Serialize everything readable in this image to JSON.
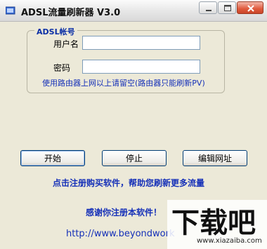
{
  "window": {
    "title": "ADSL流量刷新器 V3.0",
    "icon": "app-icon"
  },
  "controls": {
    "minimize": "minimize-icon",
    "maximize": "maximize-icon",
    "close": "close-icon"
  },
  "account": {
    "group_title": "ADSL帐号",
    "username_label": "用户名",
    "username_value": "",
    "password_label": "密码",
    "password_value": "",
    "hint": "使用路由器上网以上请留空(路由器只能刷新PV)"
  },
  "buttons": {
    "start": "开始",
    "stop": "停止",
    "edit_url": "编辑网址"
  },
  "promo": "点击注册购买软件，帮助您刷新更多流量",
  "thanks": "感谢你注册本软件！",
  "link": "http://www.beyondwork",
  "watermark": {
    "logo_text": "下载吧",
    "url_text": "www.xiazaiba.com"
  },
  "colors": {
    "accent_blue": "#1530b8",
    "window_bg": "#ece9d8"
  }
}
